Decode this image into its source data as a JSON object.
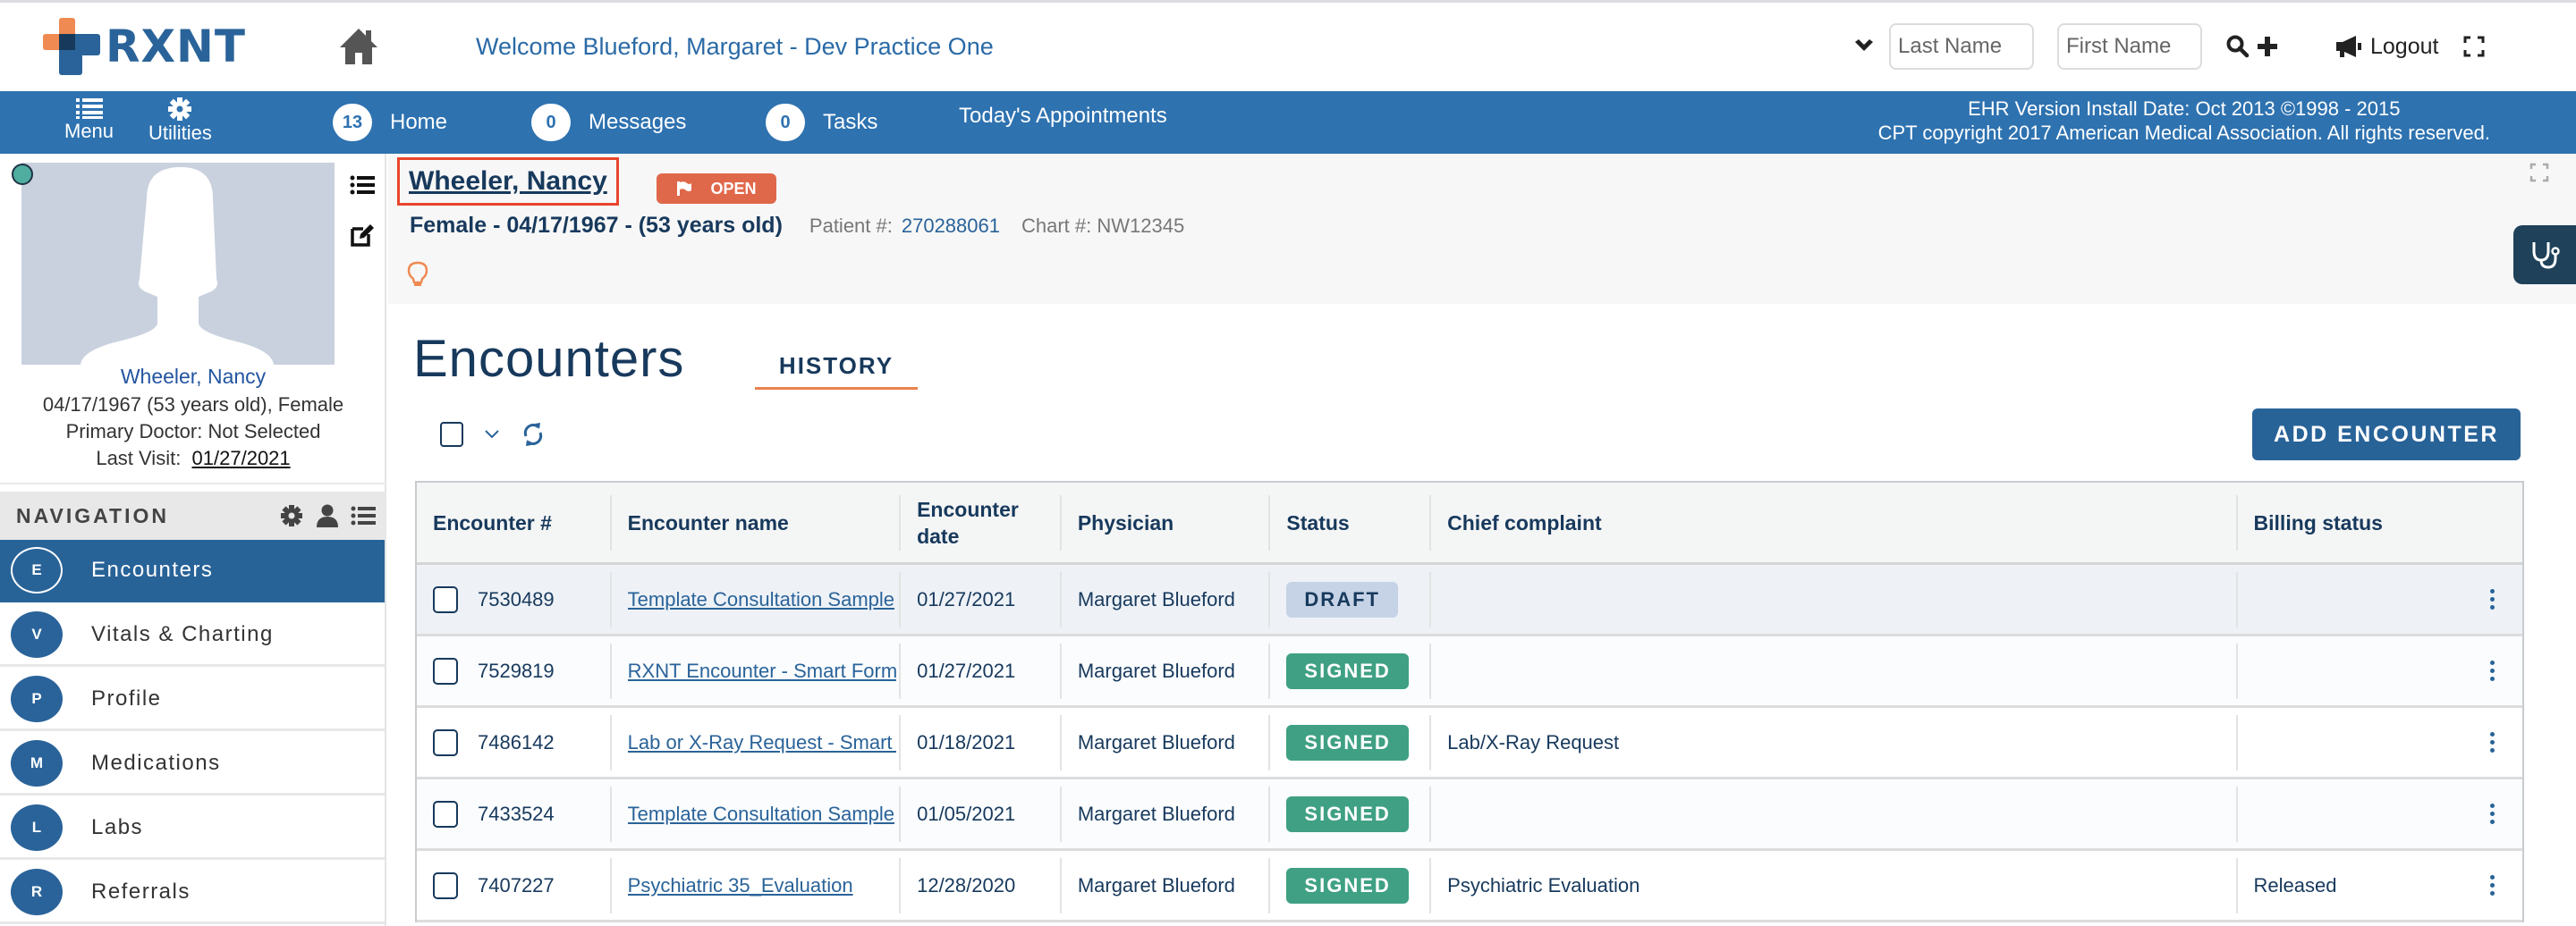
{
  "header": {
    "logo_text": "RXNT",
    "welcome": "Welcome  Blueford, Margaret - Dev Practice One",
    "search": {
      "last_name_placeholder": "Last Name",
      "first_name_placeholder": "First Name",
      "last_name_value": "",
      "first_name_value": ""
    },
    "logout_label": "Logout"
  },
  "navbar": {
    "menu_label": "Menu",
    "utilities_label": "Utilities",
    "items": [
      {
        "badge": "13",
        "label": "Home"
      },
      {
        "badge": "0",
        "label": "Messages"
      },
      {
        "badge": "0",
        "label": "Tasks"
      },
      {
        "badge": null,
        "label": "Today's Appointments"
      }
    ],
    "version_line1": "EHR Version Install Date: Oct 2013 ©1998 - 2015",
    "version_line2": "CPT copyright 2017 American Medical Association. All rights reserved."
  },
  "patient_card": {
    "name": "Wheeler, Nancy",
    "dob_line": "04/17/1967 (53 years old), Female",
    "doctor_line": "Primary Doctor: Not Selected",
    "last_visit_label": "Last Visit:",
    "last_visit_value": "01/27/2021",
    "status_color": "#4fae9f"
  },
  "navigation": {
    "title": "NAVIGATION",
    "items": [
      {
        "letter": "E",
        "label": "Encounters",
        "active": true
      },
      {
        "letter": "V",
        "label": "Vitals & Charting",
        "active": false
      },
      {
        "letter": "P",
        "label": "Profile",
        "active": false
      },
      {
        "letter": "M",
        "label": "Medications",
        "active": false
      },
      {
        "letter": "L",
        "label": "Labs",
        "active": false
      },
      {
        "letter": "R",
        "label": "Referrals",
        "active": false
      }
    ]
  },
  "patient_header": {
    "name": "Wheeler, Nancy",
    "flag_label": "OPEN",
    "demographics": "Female - 04/17/1967 - (53 years old)",
    "patient_num_label": "Patient #:",
    "patient_num": "270288061",
    "chart_num": "Chart #: NW12345"
  },
  "encounters": {
    "title": "Encounters",
    "tab_history": "HISTORY",
    "add_button": "ADD ENCOUNTER",
    "columns": [
      "Encounter #",
      "Encounter name",
      "Encounter date",
      "Physician",
      "Status",
      "Chief complaint",
      "Billing status"
    ],
    "rows": [
      {
        "id": "7530489",
        "name": "Template Consultation Sample",
        "date": "01/27/2021",
        "physician": "Margaret Blueford",
        "status": "DRAFT",
        "complaint": "",
        "billing": ""
      },
      {
        "id": "7529819",
        "name": "RXNT Encounter - Smart Form",
        "date": "01/27/2021",
        "physician": "Margaret Blueford",
        "status": "SIGNED",
        "complaint": "",
        "billing": ""
      },
      {
        "id": "7486142",
        "name": "Lab or X-Ray Request - Smart Form",
        "date": "01/18/2021",
        "physician": "Margaret Blueford",
        "status": "SIGNED",
        "complaint": "Lab/X-Ray Request",
        "billing": ""
      },
      {
        "id": "7433524",
        "name": "Template Consultation Sample",
        "date": "01/05/2021",
        "physician": "Margaret Blueford",
        "status": "SIGNED",
        "complaint": "",
        "billing": ""
      },
      {
        "id": "7407227",
        "name": "Psychiatric 35_Evaluation",
        "date": "12/28/2020",
        "physician": "Margaret Blueford",
        "status": "SIGNED",
        "complaint": "Psychiatric Evaluation",
        "billing": "Released"
      }
    ]
  },
  "colors": {
    "brand_blue": "#2e72b0",
    "nav_active": "#286398",
    "accent_orange": "#e9834e",
    "signed_green": "#3fa083",
    "draft_blue": "#c6d3e6",
    "open_flag": "#e0684a"
  }
}
